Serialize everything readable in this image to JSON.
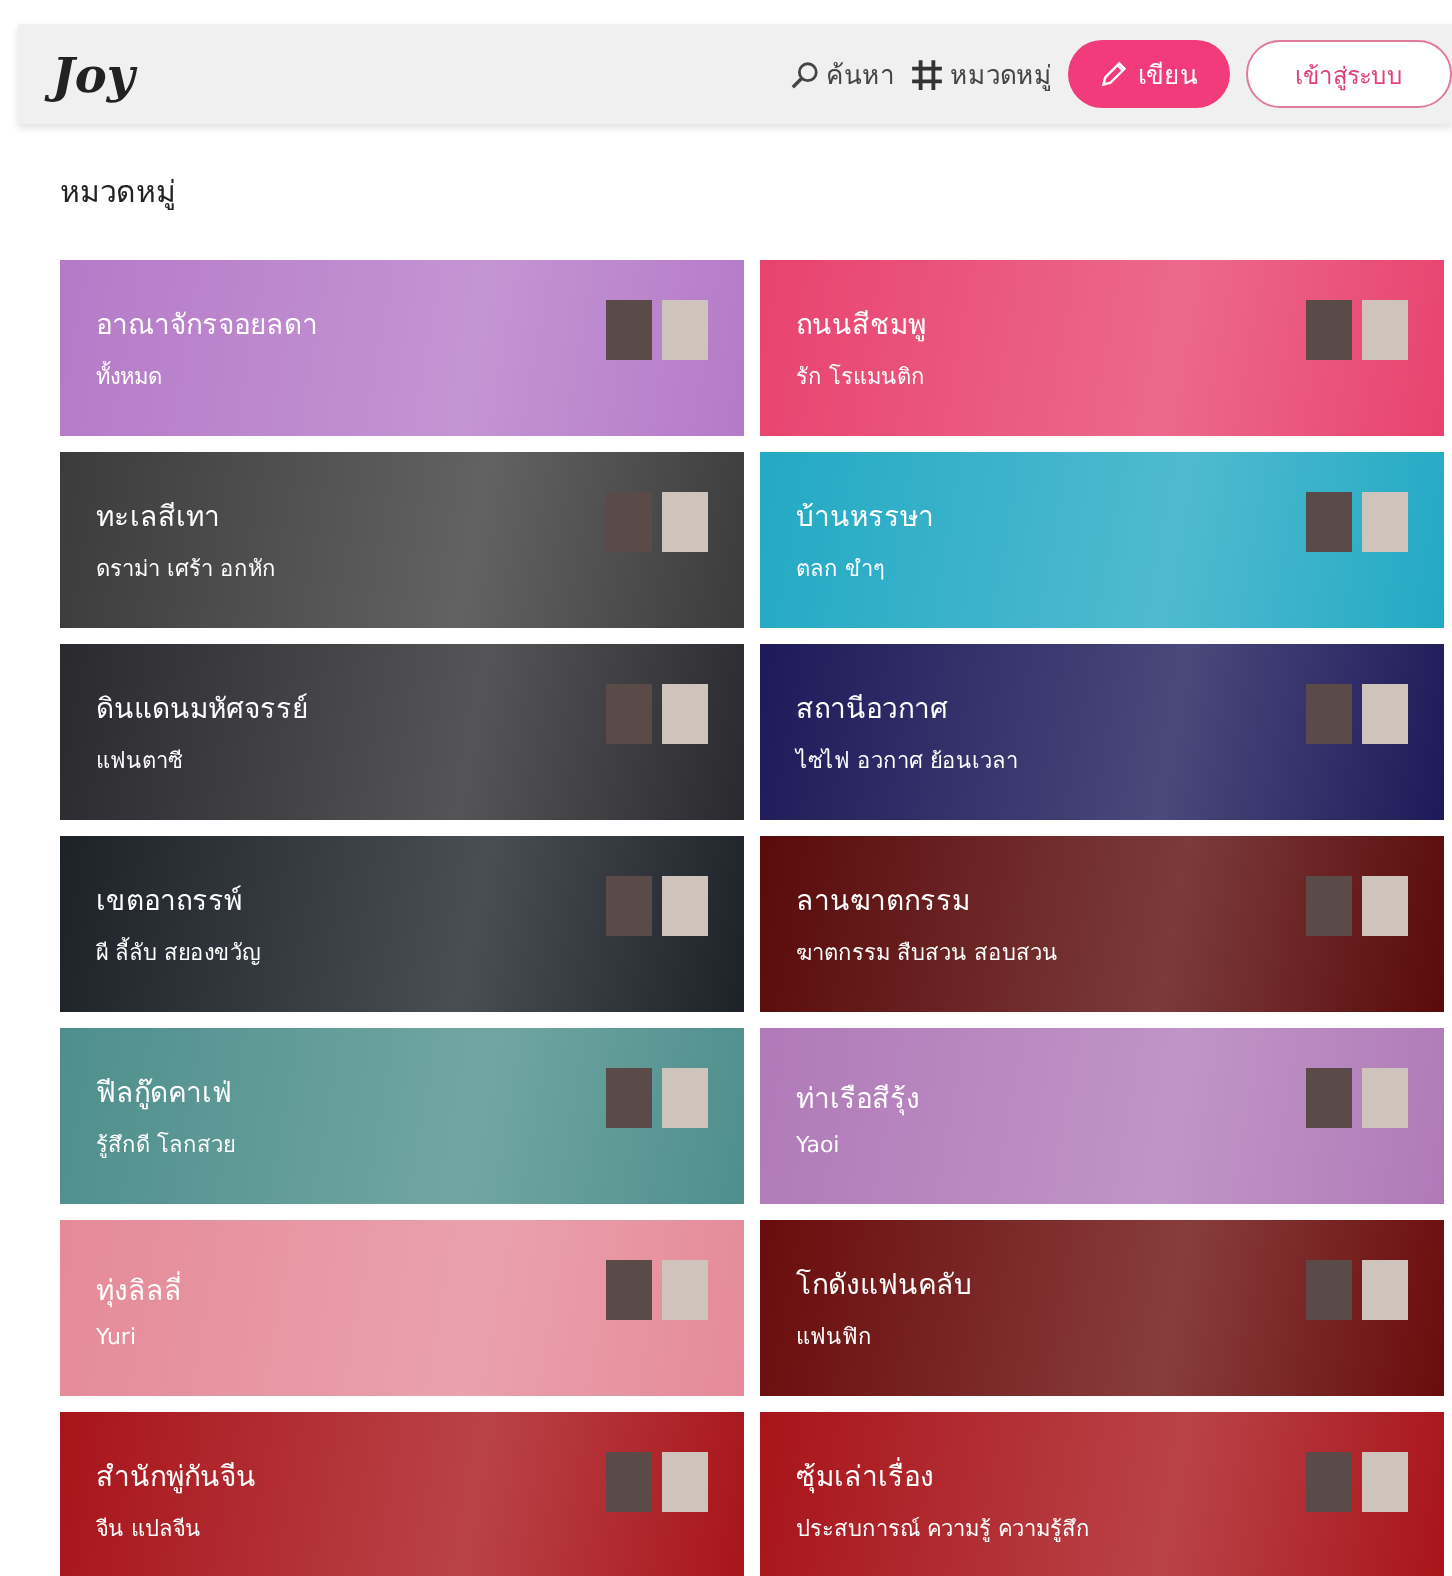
{
  "header": {
    "logo": "Joy",
    "nav": [
      {
        "kind": "search",
        "label": "ค้นหา"
      },
      {
        "kind": "hash",
        "label": "หมวดหมู่"
      }
    ],
    "write_button": "เขียน",
    "login_button": "เข้าสู่ระบบ"
  },
  "page_title": "หมวดหมู่",
  "categories": [
    {
      "title": "อาณาจักรจอยลดา",
      "tags": "ทั้งหมด",
      "color": "#b57ac8"
    },
    {
      "title": "ถนนสีชมพู",
      "tags": "รัก โรแมนติก",
      "color": "#e8436f"
    },
    {
      "title": "ทะเลสีเทา",
      "tags": "ดราม่า เศร้า อกหัก",
      "color": "#3a3b3a"
    },
    {
      "title": "บ้านหรรษา",
      "tags": "ตลก ขำๆ",
      "color": "#23a9c4"
    },
    {
      "title": "ดินแดนมหัศจรรย์",
      "tags": "แฟนตาซี",
      "color": "#2a2a2e"
    },
    {
      "title": "สถานีอวกาศ",
      "tags": "ไซไฟ อวกาศ ย้อนเวลา",
      "color": "#1e1a5a"
    },
    {
      "title": "เขตอาถรรพ์",
      "tags": "ผี ลี้ลับ สยองขวัญ",
      "color": "#1c2228"
    },
    {
      "title": "ลานฆาตกรรม",
      "tags": "ฆาตกรรม สืบสวน สอบสวน",
      "color": "#5a0a0a"
    },
    {
      "title": "ฟีลกู๊ดคาเฟ่",
      "tags": "รู้สึกดี โลกสวย",
      "color": "#4e8f8c"
    },
    {
      "title": "ท่าเรือสีรุ้ง",
      "tags": "Yaoi",
      "color": "#b07ab8"
    },
    {
      "title": "ทุ่งลิลลี่",
      "tags": "Yuri",
      "color": "#e58a98"
    },
    {
      "title": "โกดังแฟนคลับ",
      "tags": "แฟนฟิก",
      "color": "#6a0c0c"
    },
    {
      "title": "สำนักพู่กันจีน",
      "tags": "จีน แปลจีน",
      "color": "#a8141a"
    },
    {
      "title": "ซุ้มเล่าเรื่อง",
      "tags": "ประสบการณ์ ความรู้ ความรู้สึก",
      "color": "#a8141a"
    }
  ]
}
